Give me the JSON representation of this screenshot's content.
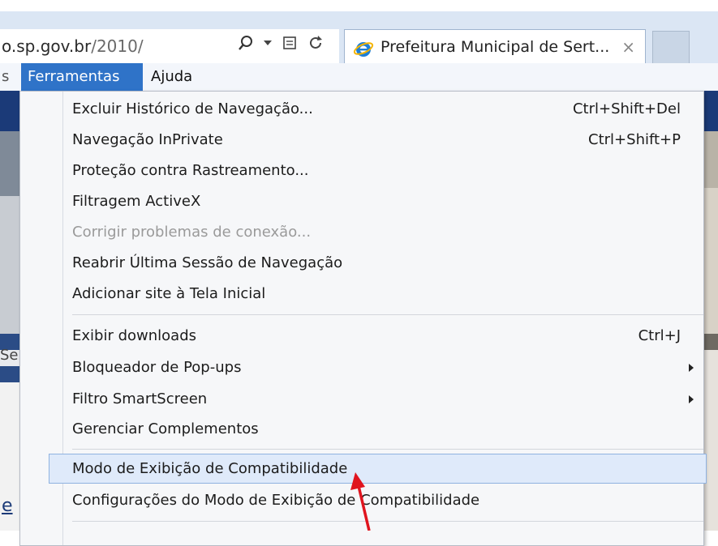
{
  "browser": {
    "address": {
      "host": "o.sp.gov.br",
      "path": "/2010/"
    },
    "tab": {
      "title": "Prefeitura Municipal de Sert...",
      "close_glyph": "×"
    }
  },
  "menubar": {
    "fragment": "s",
    "ferramentas": "Ferramentas",
    "ajuda": "Ajuda"
  },
  "page_fragments": {
    "se": "Se",
    "e": "e"
  },
  "tools_menu": {
    "group1": [
      {
        "label": "Excluir Histórico de Navegação...",
        "shortcut": "Ctrl+Shift+Del"
      },
      {
        "label": "Navegação InPrivate",
        "shortcut": "Ctrl+Shift+P"
      },
      {
        "label": "Proteção contra Rastreamento...",
        "shortcut": ""
      },
      {
        "label": "Filtragem ActiveX",
        "shortcut": ""
      },
      {
        "label": "Corrigir problemas de conexão...",
        "shortcut": ""
      },
      {
        "label": "Reabrir Última Sessão de Navegação",
        "shortcut": ""
      },
      {
        "label": "Adicionar site à Tela Inicial",
        "shortcut": ""
      }
    ],
    "group2": [
      {
        "label": "Exibir downloads",
        "shortcut": "Ctrl+J"
      },
      {
        "label": "Bloqueador de Pop-ups",
        "shortcut": ""
      },
      {
        "label": "Filtro SmartScreen",
        "shortcut": ""
      },
      {
        "label": "Gerenciar Complementos",
        "shortcut": ""
      }
    ],
    "group3": [
      {
        "label": "Modo de Exibição de Compatibilidade",
        "shortcut": ""
      },
      {
        "label": "Configurações do Modo de Exibição de Compatibilidade",
        "shortcut": ""
      }
    ]
  },
  "colors": {
    "menubar_selected": "#2f73c8",
    "highlight_row": "#dfeafa",
    "annotation_arrow": "#e0141e",
    "disabled_text": "#9a9a9a"
  }
}
